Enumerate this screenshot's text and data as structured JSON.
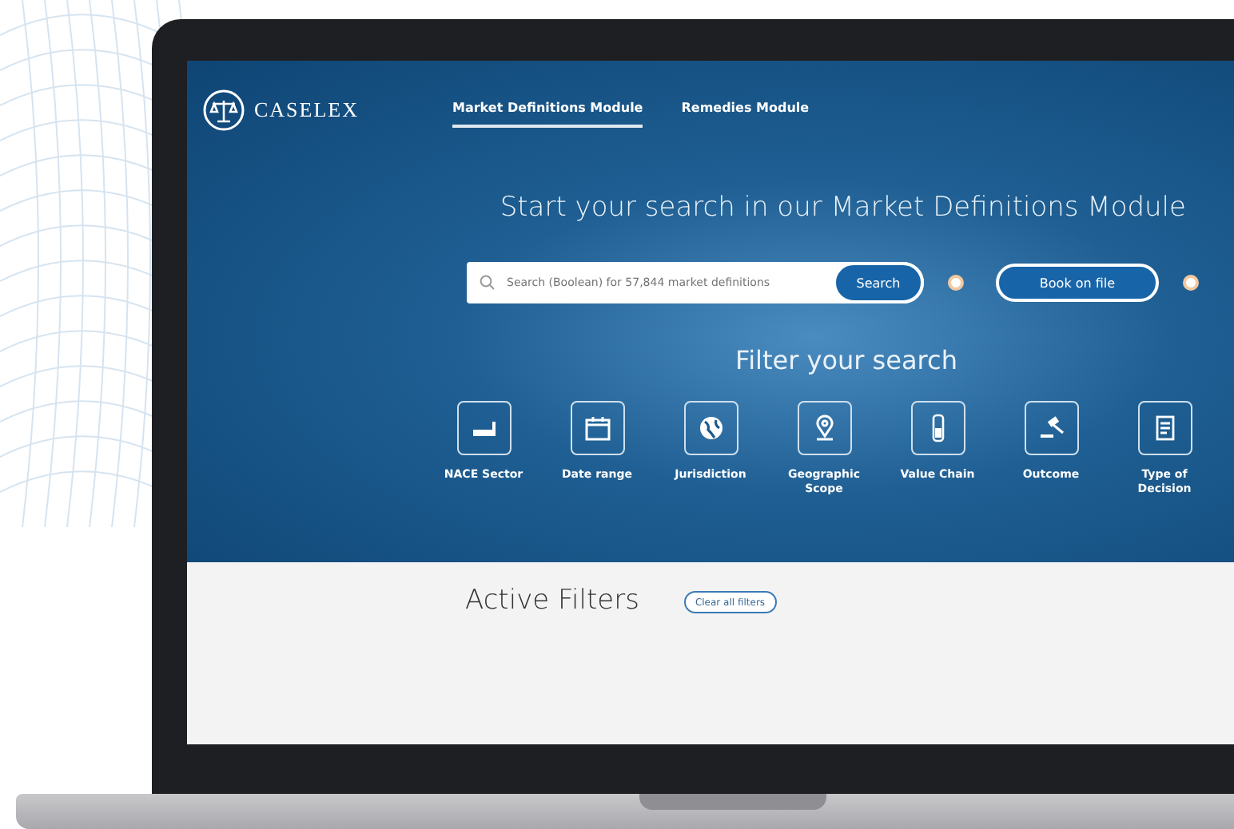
{
  "logo": {
    "name": "CASELEX"
  },
  "nav_tabs": [
    {
      "label": "Market Definitions Module",
      "selected": true
    },
    {
      "label": "Remedies Module",
      "selected": false
    }
  ],
  "heading": "Start your search in our Market Definitions Module",
  "search": {
    "placeholder": "Search (Boolean) for 57,844 market definitions",
    "button": "Search"
  },
  "book_button": "Book on file",
  "filter_heading": "Filter your search",
  "filters": [
    {
      "label": "NACE Sector",
      "kind": "sector"
    },
    {
      "label": "Date range",
      "kind": "calendar"
    },
    {
      "label": "Jurisdiction",
      "kind": "globe"
    },
    {
      "label": "Geographic Scope",
      "kind": "pin"
    },
    {
      "label": "Value Chain",
      "kind": "chain"
    },
    {
      "label": "Outcome",
      "kind": "gavel"
    },
    {
      "label": "Type of Decision",
      "kind": "document"
    }
  ],
  "active_filters": {
    "title": "Active Filters",
    "clear_button": "Clear all filters"
  }
}
